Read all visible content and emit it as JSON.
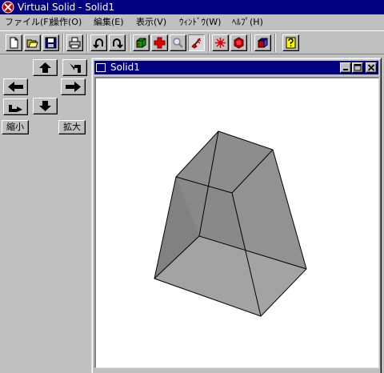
{
  "app": {
    "title": "Virtual Solid - Solid1"
  },
  "menu": [
    {
      "label": "ファイル(F)"
    },
    {
      "label": "操作(O)"
    },
    {
      "label": "編集(E)"
    },
    {
      "label": "表示(V)"
    },
    {
      "label": "ｳｨﾝﾄﾞｳ(W)"
    },
    {
      "label": "ﾍﾙﾌﾟ(H)"
    }
  ],
  "toolbar": {
    "icons": [
      "new-file-icon",
      "open-folder-icon",
      "save-disk-icon",
      "print-icon",
      "rotate-left-icon",
      "rotate-right-icon",
      "green-box-icon",
      "red-cross-icon",
      "magnifier-icon",
      "eraser-icon",
      "red-star-icon",
      "red-polyhedron-icon",
      "blue-cube-icon",
      "help-question-icon"
    ]
  },
  "nav": {
    "zoom_out_label": "縮小",
    "zoom_in_label": "拡大"
  },
  "child_window": {
    "title": "Solid1"
  },
  "colors": {
    "titlebar": "#000080",
    "face_light": "#a3a3a3",
    "face_mid": "#959595",
    "face_dark": "#808080",
    "edge": "#000000"
  }
}
